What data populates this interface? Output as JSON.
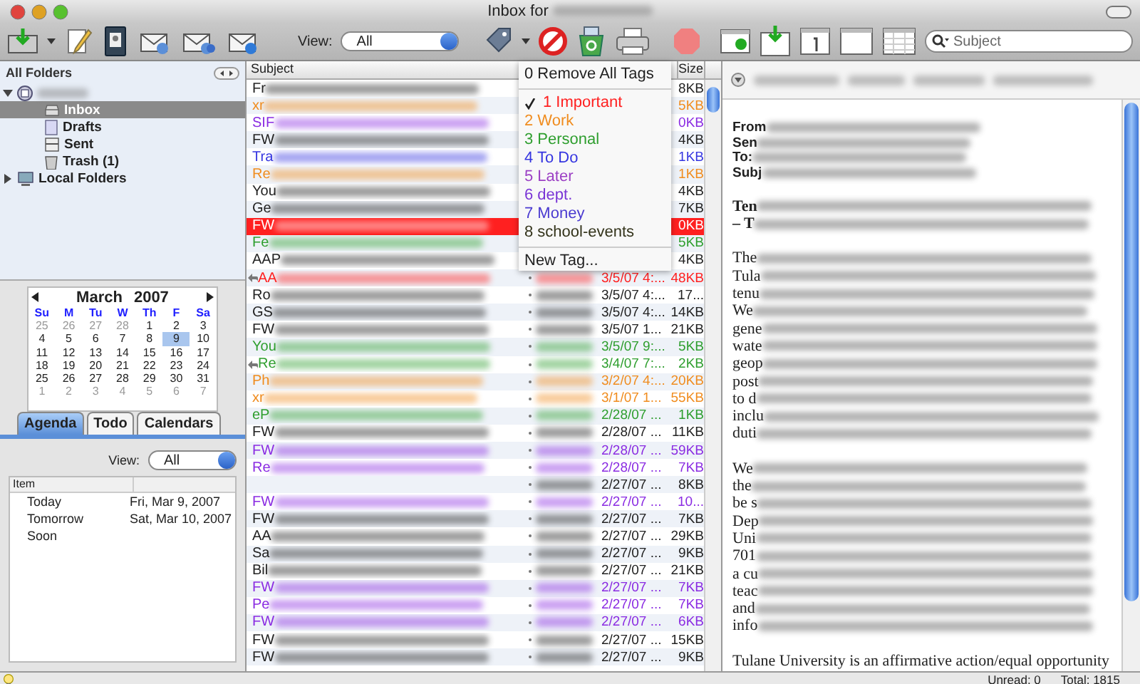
{
  "window": {
    "title": "Inbox for"
  },
  "toolbar": {
    "view_label": "View:",
    "view_value": "All",
    "search_placeholder": "Subject"
  },
  "folders": {
    "header": "All Folders",
    "tree": [
      {
        "kind": "account",
        "expanded": true,
        "children": [
          {
            "label": "Inbox",
            "kind": "inbox",
            "selected": true
          },
          {
            "label": "Drafts",
            "kind": "drafts",
            "selected": false
          },
          {
            "label": "Sent",
            "kind": "sent",
            "selected": false
          },
          {
            "label": "Trash (1)",
            "kind": "trash",
            "selected": false
          }
        ]
      },
      {
        "label": "Local Folders",
        "kind": "local",
        "expanded": false,
        "selected": false
      }
    ]
  },
  "calendar": {
    "month": "March",
    "year": "2007",
    "weekdays": [
      "Su",
      "M",
      "Tu",
      "W",
      "Th",
      "F",
      "Sa"
    ],
    "days": [
      {
        "label": "25",
        "in_month": false,
        "selected": false
      },
      {
        "label": "26",
        "in_month": false,
        "selected": false
      },
      {
        "label": "27",
        "in_month": false,
        "selected": false
      },
      {
        "label": "28",
        "in_month": false,
        "selected": false
      },
      {
        "label": "1",
        "in_month": true,
        "selected": false
      },
      {
        "label": "2",
        "in_month": true,
        "selected": false
      },
      {
        "label": "3",
        "in_month": true,
        "selected": false
      },
      {
        "label": "4",
        "in_month": true,
        "selected": false
      },
      {
        "label": "5",
        "in_month": true,
        "selected": false
      },
      {
        "label": "6",
        "in_month": true,
        "selected": false
      },
      {
        "label": "7",
        "in_month": true,
        "selected": false
      },
      {
        "label": "8",
        "in_month": true,
        "selected": false
      },
      {
        "label": "9",
        "in_month": true,
        "selected": true
      },
      {
        "label": "10",
        "in_month": true,
        "selected": false
      },
      {
        "label": "11",
        "in_month": true,
        "selected": false
      },
      {
        "label": "12",
        "in_month": true,
        "selected": false
      },
      {
        "label": "13",
        "in_month": true,
        "selected": false
      },
      {
        "label": "14",
        "in_month": true,
        "selected": false
      },
      {
        "label": "15",
        "in_month": true,
        "selected": false
      },
      {
        "label": "16",
        "in_month": true,
        "selected": false
      },
      {
        "label": "17",
        "in_month": true,
        "selected": false
      },
      {
        "label": "18",
        "in_month": true,
        "selected": false
      },
      {
        "label": "19",
        "in_month": true,
        "selected": false
      },
      {
        "label": "20",
        "in_month": true,
        "selected": false
      },
      {
        "label": "21",
        "in_month": true,
        "selected": false
      },
      {
        "label": "22",
        "in_month": true,
        "selected": false
      },
      {
        "label": "23",
        "in_month": true,
        "selected": false
      },
      {
        "label": "24",
        "in_month": true,
        "selected": false
      },
      {
        "label": "25",
        "in_month": true,
        "selected": false
      },
      {
        "label": "26",
        "in_month": true,
        "selected": false
      },
      {
        "label": "27",
        "in_month": true,
        "selected": false
      },
      {
        "label": "28",
        "in_month": true,
        "selected": false
      },
      {
        "label": "29",
        "in_month": true,
        "selected": false
      },
      {
        "label": "30",
        "in_month": true,
        "selected": false
      },
      {
        "label": "31",
        "in_month": true,
        "selected": false
      },
      {
        "label": "1",
        "in_month": false,
        "selected": false
      },
      {
        "label": "2",
        "in_month": false,
        "selected": false
      },
      {
        "label": "3",
        "in_month": false,
        "selected": false
      },
      {
        "label": "4",
        "in_month": false,
        "selected": false
      },
      {
        "label": "5",
        "in_month": false,
        "selected": false
      },
      {
        "label": "6",
        "in_month": false,
        "selected": false
      },
      {
        "label": "7",
        "in_month": false,
        "selected": false
      }
    ]
  },
  "agenda_tabs": [
    {
      "label": "Agenda",
      "selected": true
    },
    {
      "label": "Todo",
      "selected": false
    },
    {
      "label": "Calendars",
      "selected": false
    }
  ],
  "agenda": {
    "view_label": "View:",
    "view_value": "All",
    "column_1": "Item",
    "rows": [
      {
        "item": "Today",
        "date": "Fri, Mar 9, 2007"
      },
      {
        "item": "Tomorrow",
        "date": "Sat, Mar 10, 2007"
      },
      {
        "item": "Soon"
      }
    ]
  },
  "messages": {
    "columns": {
      "subject": "Subject",
      "size": "Size"
    },
    "rows": [
      {
        "subject": "Fr",
        "size": "8KB",
        "color": "#222222",
        "selected": false,
        "replied": false
      },
      {
        "subject": "xr",
        "size": "5KB",
        "color": "#f08c1e",
        "selected": false,
        "replied": false
      },
      {
        "subject": "SIF",
        "size": "0KB",
        "color": "#8a2be2",
        "selected": false,
        "replied": false
      },
      {
        "subject": "FW",
        "size": "4KB",
        "color": "#222222",
        "selected": false,
        "replied": false
      },
      {
        "subject": "Tra",
        "size": "1KB",
        "color": "#3535e0",
        "selected": false,
        "replied": false
      },
      {
        "subject": "Re",
        "size": "1KB",
        "color": "#f08c1e",
        "selected": false,
        "replied": false
      },
      {
        "subject": "You",
        "size": "4KB",
        "color": "#222222",
        "selected": false,
        "replied": false
      },
      {
        "subject": "Ge",
        "size": "7KB",
        "color": "#222222",
        "selected": false,
        "replied": false
      },
      {
        "subject": "FW",
        "size": "0KB",
        "color": "#ff2020",
        "selected": true,
        "replied": false
      },
      {
        "subject": "Fe",
        "size": "5KB",
        "color": "#2e9e2e",
        "selected": false,
        "replied": false
      },
      {
        "subject": "AAP",
        "size": "4KB",
        "color": "#222222",
        "selected": false,
        "replied": false
      },
      {
        "subject": "AA",
        "date": "3/5/07 4:...",
        "size": "48KB",
        "color": "#ff2020",
        "selected": false,
        "replied": true
      },
      {
        "subject": "Ro",
        "date": "3/5/07 4:...",
        "size": "17...",
        "color": "#222222",
        "selected": false,
        "replied": false
      },
      {
        "subject": "GS",
        "date": "3/5/07 4:...",
        "size": "14KB",
        "color": "#222222",
        "selected": false,
        "replied": false
      },
      {
        "subject": "FW",
        "date": "3/5/07 1...",
        "size": "21KB",
        "color": "#222222",
        "selected": false,
        "replied": false
      },
      {
        "subject": "You",
        "date": "3/5/07 9:...",
        "size": "5KB",
        "color": "#2e9e2e",
        "selected": false,
        "replied": false
      },
      {
        "subject": "Re",
        "date": "3/4/07 7:...",
        "size": "2KB",
        "color": "#2e9e2e",
        "selected": false,
        "replied": true
      },
      {
        "subject": "Ph",
        "date": "3/2/07 4:...",
        "size": "20KB",
        "color": "#f08c1e",
        "selected": false,
        "replied": false
      },
      {
        "subject": "xr",
        "date": "3/1/07 1...",
        "size": "55KB",
        "color": "#f08c1e",
        "selected": false,
        "replied": false
      },
      {
        "subject": "eP",
        "date": "2/28/07 ...",
        "size": "1KB",
        "color": "#2e9e2e",
        "selected": false,
        "replied": false
      },
      {
        "subject": "FW",
        "date": "2/28/07 ...",
        "size": "11KB",
        "color": "#222222",
        "selected": false,
        "replied": false
      },
      {
        "subject": "FW",
        "date": "2/28/07 ...",
        "size": "59KB",
        "color": "#8a2be2",
        "selected": false,
        "replied": false
      },
      {
        "subject": "Re",
        "date": "2/28/07 ...",
        "size": "7KB",
        "color": "#8a2be2",
        "selected": false,
        "replied": false
      },
      {
        "date": "2/27/07 ...",
        "size": "8KB",
        "color": "#222222",
        "selected": false,
        "replied": false
      },
      {
        "subject": "FW",
        "date": "2/27/07 ...",
        "size": "10...",
        "color": "#8a2be2",
        "selected": false,
        "replied": false
      },
      {
        "subject": "FW",
        "date": "2/27/07 ...",
        "size": "7KB",
        "color": "#222222",
        "selected": false,
        "replied": false
      },
      {
        "subject": "AA",
        "date": "2/27/07 ...",
        "size": "29KB",
        "color": "#222222",
        "selected": false,
        "replied": false
      },
      {
        "subject": "Sa",
        "date": "2/27/07 ...",
        "size": "9KB",
        "color": "#222222",
        "selected": false,
        "replied": false
      },
      {
        "subject": "Bil",
        "date": "2/27/07 ...",
        "size": "21KB",
        "color": "#222222",
        "selected": false,
        "replied": false
      },
      {
        "subject": "FW",
        "date": "2/27/07 ...",
        "size": "7KB",
        "color": "#8a2be2",
        "selected": false,
        "replied": false
      },
      {
        "subject": "Pe",
        "date": "2/27/07 ...",
        "size": "7KB",
        "color": "#8a2be2",
        "selected": false,
        "replied": false
      },
      {
        "subject": "FW",
        "date": "2/27/07 ...",
        "size": "6KB",
        "color": "#8a2be2",
        "selected": false,
        "replied": false
      },
      {
        "subject": "FW",
        "date": "2/27/07 ...",
        "size": "15KB",
        "color": "#222222",
        "selected": false,
        "replied": false
      },
      {
        "subject": "FW",
        "date": "2/27/07 ...",
        "size": "9KB",
        "color": "#222222",
        "selected": false,
        "replied": false
      }
    ]
  },
  "tag_menu": {
    "items": [
      {
        "kind": "action",
        "label": "0 Remove All Tags"
      },
      {
        "kind": "separator"
      },
      {
        "kind": "tag",
        "label": "1 Important",
        "color": "#ff2020",
        "checked": true
      },
      {
        "kind": "tag",
        "label": "2 Work",
        "color": "#f08c1e",
        "checked": false
      },
      {
        "kind": "tag",
        "label": "3 Personal",
        "color": "#2e9e2e",
        "checked": false
      },
      {
        "kind": "tag",
        "label": "4 To Do",
        "color": "#3535e0",
        "checked": false
      },
      {
        "kind": "tag",
        "label": "5 Later",
        "color": "#9b3fc4",
        "checked": false
      },
      {
        "kind": "tag",
        "label": "6 dept.",
        "color": "#7a35d6",
        "checked": false
      },
      {
        "kind": "tag",
        "label": "7 Money",
        "color": "#4a3ad0",
        "checked": false
      },
      {
        "kind": "tag",
        "label": "8 school-events",
        "color": "#33331a",
        "checked": false
      },
      {
        "kind": "separator"
      },
      {
        "kind": "action",
        "label": "New Tag..."
      }
    ]
  },
  "message": {
    "paragraphs": [
      {
        "kind": "header",
        "lines": [
          {
            "text": "From",
            "blurred": true
          },
          {
            "text": "Sen",
            "blurred": true
          },
          {
            "text": "To:",
            "blurred": true
          },
          {
            "text": "Subj",
            "blurred": true
          }
        ]
      },
      {
        "kind": "title",
        "lines": [
          {
            "text": "Ten",
            "blurred": true
          },
          {
            "text": "– T",
            "blurred": true
          }
        ]
      },
      {
        "kind": "body",
        "lines": [
          {
            "text": "The",
            "blurred": true
          },
          {
            "text": "Tula",
            "blurred": true
          },
          {
            "text": "tenu",
            "blurred": true
          },
          {
            "text": "We",
            "blurred": true
          },
          {
            "text": "gene",
            "blurred": true
          },
          {
            "text": "wate",
            "blurred": true
          },
          {
            "text": "geop",
            "blurred": true
          },
          {
            "text": "post",
            "blurred": true
          },
          {
            "text": "to d",
            "blurred": true
          },
          {
            "text": "inclu",
            "blurred": true
          },
          {
            "text": "duti",
            "blurred": true
          }
        ]
      },
      {
        "kind": "body",
        "lines": [
          {
            "text": "We",
            "blurred": true
          },
          {
            "text": "the",
            "blurred": true
          },
          {
            "text": "be s",
            "blurred": true
          },
          {
            "text": "Dep",
            "blurred": true
          },
          {
            "text": "Uni",
            "blurred": true
          },
          {
            "text": "701",
            "blurred": true
          },
          {
            "text": "a cu",
            "blurred": true
          },
          {
            "text": "teac",
            "blurred": true
          },
          {
            "text": "and",
            "blurred": true
          },
          {
            "text": "info",
            "blurred": true
          }
        ]
      },
      {
        "kind": "body",
        "lines": [
          {
            "text": "Tulane University is an affirmative action/equal opportunity",
            "blurred": false
          }
        ]
      }
    ]
  },
  "status_bar": {
    "unread": "Unread: 0",
    "total": "Total: 1815"
  }
}
